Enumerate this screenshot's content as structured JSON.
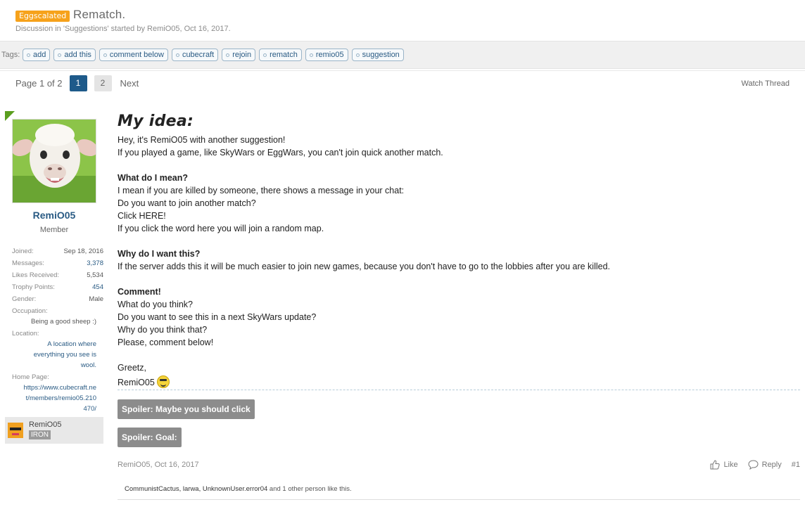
{
  "thread": {
    "prefix": "Eggscalated",
    "title": "Rematch.",
    "description_prefix": "Discussion in '",
    "forum": "Suggestions",
    "description_mid": "' started by ",
    "author": "RemiO05",
    "description_sep": ", ",
    "date": "Oct 16, 2017."
  },
  "tags": {
    "label": "Tags:",
    "items": [
      "add",
      "add this",
      "comment below",
      "cubecraft",
      "rejoin",
      "rematch",
      "remio05",
      "suggestion"
    ]
  },
  "pagenav": {
    "label": "Page 1 of 2",
    "pages": [
      "1",
      "2"
    ],
    "next": "Next",
    "watch": "Watch Thread"
  },
  "user": {
    "name": "RemiO05",
    "title": "Member",
    "joined_label": "Joined:",
    "joined": "Sep 18, 2016",
    "messages_label": "Messages:",
    "messages": "3,378",
    "likes_label": "Likes Received:",
    "likes": "5,534",
    "trophy_label": "Trophy Points:",
    "trophy": "454",
    "gender_label": "Gender:",
    "gender": "Male",
    "occupation_label": "Occupation:",
    "occupation": "Being a good sheep :)",
    "location_label": "Location:",
    "location_lines": [
      "A location where",
      "everything you see is",
      "wool."
    ],
    "homepage_label": "Home Page:",
    "homepage_lines": [
      "https://www.cubecraft.ne",
      "t/members/remio05.210",
      "470/"
    ],
    "badge_name": "RemiO05",
    "badge_rank": "IRON"
  },
  "post": {
    "heading": "My idea:",
    "lines": [
      {
        "text": "Hey, it's RemiO05 with another suggestion!",
        "bold": false
      },
      {
        "text": "If you played a game, like SkyWars or EggWars, you can't join quick another match.",
        "bold": false
      },
      {
        "text": "What do I mean?",
        "bold": true
      },
      {
        "text": "I mean if you are killed by someone, there shows a message in your chat:",
        "bold": false
      },
      {
        "text": "Do you want to join another match?",
        "bold": false
      },
      {
        "text": "Click HERE!",
        "bold": false
      },
      {
        "text": "If you click the word here you will join a random map.",
        "bold": false
      },
      {
        "text": "Why do I want this?",
        "bold": true
      },
      {
        "text": "If the server adds this it will be much easier to join new games, because you don't have to go to the lobbies after you are killed.",
        "bold": false
      },
      {
        "text": "Comment!",
        "bold": true
      },
      {
        "text": "What do you think?",
        "bold": false
      },
      {
        "text": "Do you want to see this in a next SkyWars update?",
        "bold": false
      },
      {
        "text": "Why do you think that?",
        "bold": false
      },
      {
        "text": "Please, comment below!",
        "bold": false
      },
      {
        "text": "Greetz,",
        "bold": false
      },
      {
        "text": "RemiO05",
        "bold": false
      }
    ],
    "spoiler1": "Spoiler: Maybe you should click",
    "spoiler2": "Spoiler: Goal:",
    "meta": "RemiO05, Oct 16, 2017",
    "like": "Like",
    "reply": "Reply",
    "number": "#1",
    "likes_names": "CommunistCactus, larwa, UnknownUser.error04",
    "likes_suffix": " and 1 other person like this."
  },
  "colors": {
    "prefix": "#f6a21b",
    "link": "#2a5b84",
    "active_page": "#1e5a8a",
    "online_corner": "#5a9e1e"
  }
}
